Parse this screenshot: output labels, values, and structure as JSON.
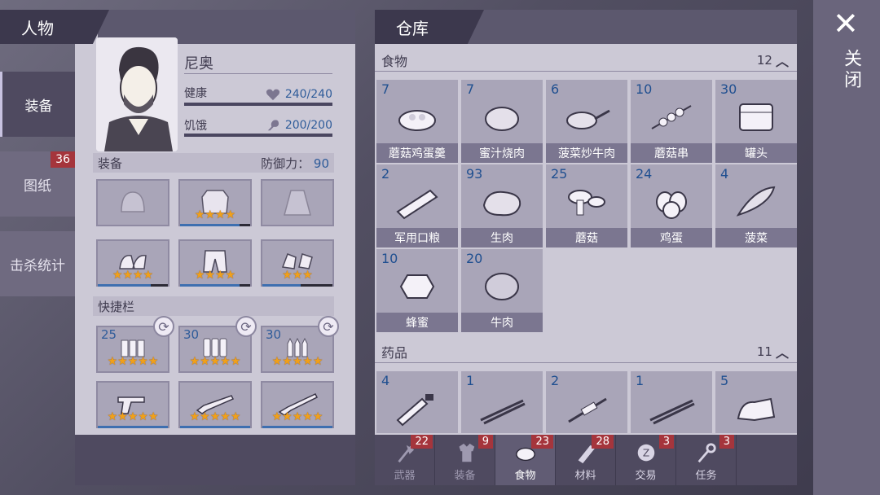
{
  "left_tabs": [
    {
      "label": "装备",
      "active": true
    },
    {
      "label": "图纸",
      "badge": "36"
    },
    {
      "label": "击杀统计"
    }
  ],
  "character": {
    "header": "人物",
    "name": "尼奥",
    "health_label": "健康",
    "health_value": "240/240",
    "hunger_label": "饥饿",
    "hunger_value": "200/200",
    "equipment_label": "装备",
    "defense_label": "防御力：",
    "defense_value": "90",
    "quickbar_label": "快捷栏",
    "quick_counts": [
      "25",
      "30",
      "30"
    ]
  },
  "warehouse": {
    "header": "仓库",
    "food_label": "食物",
    "food_count": "12",
    "medicine_label": "药品",
    "medicine_count": "11",
    "food_items": [
      {
        "count": "7",
        "name": "蘑菇鸡蛋羹"
      },
      {
        "count": "7",
        "name": "蜜汁烧肉"
      },
      {
        "count": "6",
        "name": "菠菜炒牛肉"
      },
      {
        "count": "10",
        "name": "蘑菇串"
      },
      {
        "count": "30",
        "name": "罐头"
      },
      {
        "count": "2",
        "name": "军用口粮"
      },
      {
        "count": "93",
        "name": "生肉"
      },
      {
        "count": "25",
        "name": "蘑菇"
      },
      {
        "count": "24",
        "name": "鸡蛋"
      },
      {
        "count": "4",
        "name": "菠菜"
      },
      {
        "count": "10",
        "name": "蜂蜜"
      },
      {
        "count": "20",
        "name": "牛肉"
      }
    ],
    "medicine_items": [
      {
        "count": "4"
      },
      {
        "count": "1"
      },
      {
        "count": "2"
      },
      {
        "count": "1"
      },
      {
        "count": "5"
      }
    ]
  },
  "bottom_tabs": [
    {
      "label": "武器",
      "badge": "22",
      "icon": "axe-icon"
    },
    {
      "label": "装备",
      "badge": "9",
      "icon": "shirt-icon"
    },
    {
      "label": "食物",
      "badge": "23",
      "icon": "meat-icon",
      "active": true
    },
    {
      "label": "材料",
      "badge": "28",
      "icon": "plank-icon"
    },
    {
      "label": "交易",
      "badge": "3",
      "icon": "coin-icon"
    },
    {
      "label": "任务",
      "badge": "3",
      "icon": "key-icon"
    }
  ],
  "close_label": "关闭",
  "colors": {
    "accent": "#2f5c9a",
    "badge": "#a5353c",
    "star": "#f0a01a"
  }
}
